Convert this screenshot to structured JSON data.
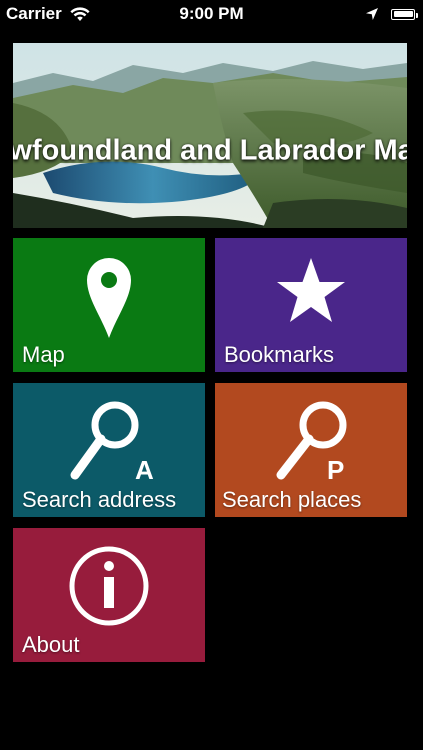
{
  "status_bar": {
    "carrier": "Carrier",
    "time": "9:00 PM",
    "icons": [
      "wifi-icon",
      "location-arrow-icon",
      "battery-icon"
    ]
  },
  "banner": {
    "title": "Newfoundland and Labrador Maps"
  },
  "tiles": [
    {
      "label": "Map",
      "icon": "map-pin-icon",
      "color": "#0a7a13"
    },
    {
      "label": "Bookmarks",
      "icon": "star-icon",
      "color": "#4a268a"
    },
    {
      "label": "Search address",
      "icon": "magnifier-a-icon",
      "badge": "A",
      "color": "#0c5a68"
    },
    {
      "label": "Search places",
      "icon": "magnifier-p-icon",
      "badge": "P",
      "color": "#b2491f"
    },
    {
      "label": "About",
      "icon": "info-icon",
      "color": "#971c3c"
    }
  ]
}
